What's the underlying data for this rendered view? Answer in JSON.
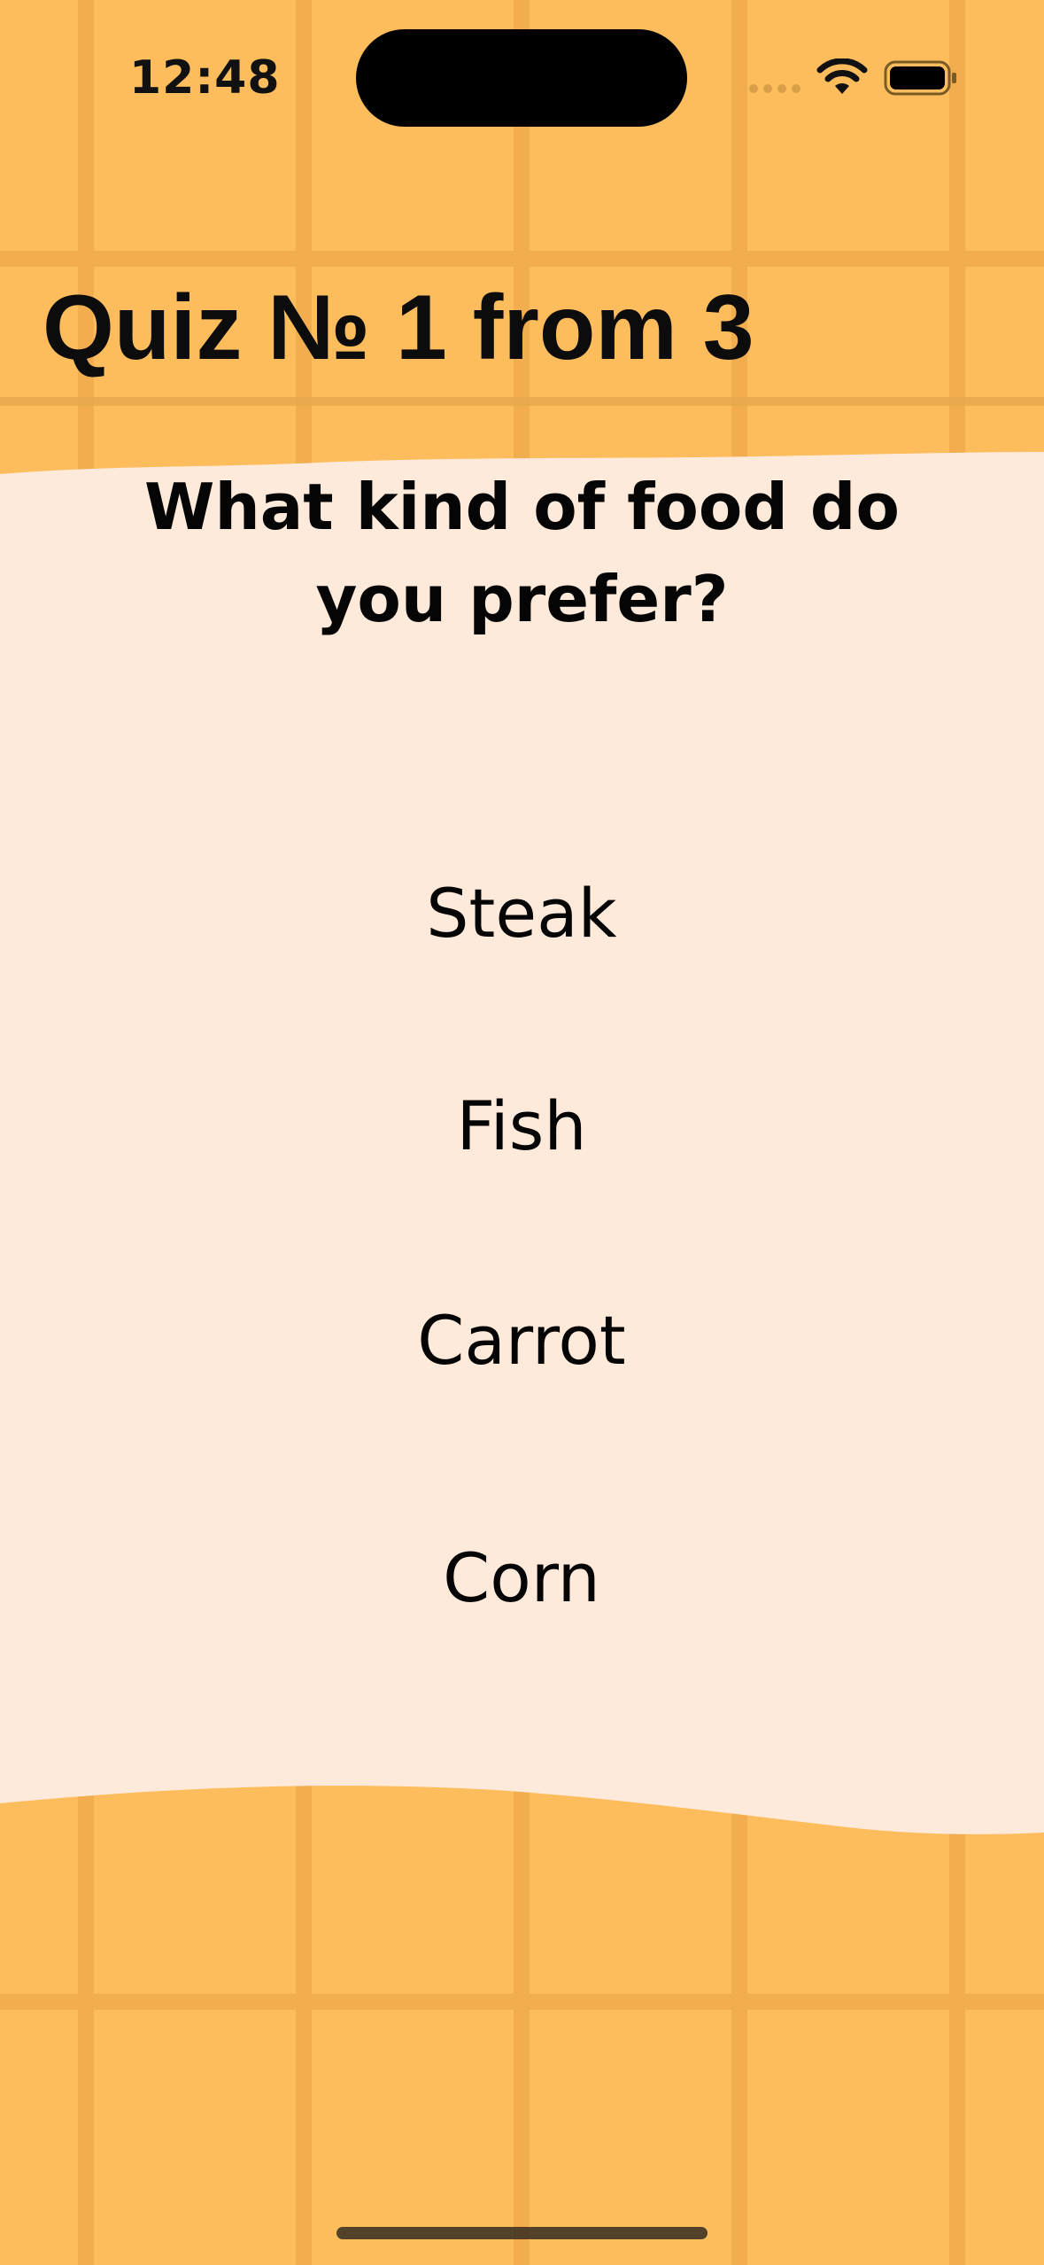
{
  "status_bar": {
    "time": "12:48"
  },
  "header": {
    "title": "Quiz № 1 from 3"
  },
  "quiz": {
    "question": "What kind of food do you prefer?",
    "options": [
      "Steak",
      "Fish",
      "Carrot",
      "Corn"
    ]
  },
  "colors": {
    "background": "#fdbd5d",
    "grid_lines": "#f2a94a",
    "paper": "#feeadb",
    "text": "#050505"
  },
  "icons": {
    "wifi": "wifi-icon",
    "battery": "battery-icon",
    "signal": "signal-dots-icon"
  }
}
